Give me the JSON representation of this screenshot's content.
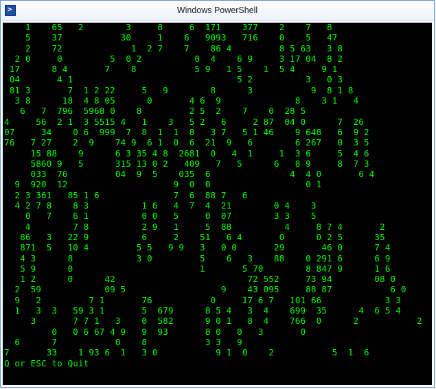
{
  "window": {
    "title": "Windows PowerShell"
  },
  "terminal": {
    "footer": "Q or ESC to Quit",
    "rows": [
      "    1    65   2        3     8     6  171    377    2    7   8",
      "    5    37           30     1    6   9093   716    0    5   47",
      "    2    72             1  2 7    7    86 4         8 5 63   3 8",
      "  2 0     0         5  0 2          0  4    6 9     3 17 04  8 2",
      " 17      8 4       7    8           5 9   1 5    1  5 4     9 1",
      " 04       4 1                               5 2          3   0 3",
      " 81 3       7  1 2 22     5   9        8      3           9  8 1 8",
      "  3 8      18  4 8 05      0       4 6  9              8    3 1   4",
      "   6   7  796  5968 0    8         2 5  2    7    0  28 5",
      "4     56  2 1  3 5515 4   1    3   5 2   6     2 87  04 0      7  26",
      "07     34    0 6  999  7  8  1  1  8   3 7   5 1 46    9 648   6  9 2",
      "76   7 27    2  9    74 9  6 1  0  6  21  9   6        6 267   0  3 5",
      "     15 88    9      6 3 35 4 8  2681  0   4  1     1  3 6     5  4 6",
      "     5860 9   5      315 13 0 2   409   7   5      6   8 9     8  7 3",
      "     033  76         04  9  5    035  6               4  4 0       6 4",
      "  9  920  12                    9  0  0                  0 1",
      "  2 3 361   85 1 6              7  6  88 7   6",
      "  4 2 7 8    8 3          1 6   4  7  4  21        0 4    3",
      "    0   7    6 1          0 0   5     0  07        3 3    5",
      "    4        7 8          2 9   1     5  88          4     8 7 4       2",
      "   86   3   22 9          6     2    51   6 4       0      0 2 5      35",
      "   871  5   10 4         5 5   9 9   3   0 0       29       46 0      7 4",
      "   4 3      8            3 0         5    6   3    88    0 291 6      6 9",
      "   5 9      0                        1       5 70        8 847 9      1 6",
      "   1 2      0      42                         72 552     73 94        08 0",
      "  2  59            09 5                  9    43 095     88 87           6 0",
      "  9   2         7 1       76           0     17 6 7   101 66            3 3",
      "  1   3  3   59 3 1       5  679      8 5 4   3  4    699  35      4  6 5 4",
      "     3       7 7 1   3    0  582      9 0 1   8  4    766  0      2           2",
      "         0   0 6 67 4 9   9  93       8 0   0   3       0",
      "  6      7           0    8           3 3   9",
      "7       33    1 93 6  1   3 0           9 1  0    2           5  1  6",
      "Q or ESC to Quit"
    ]
  }
}
